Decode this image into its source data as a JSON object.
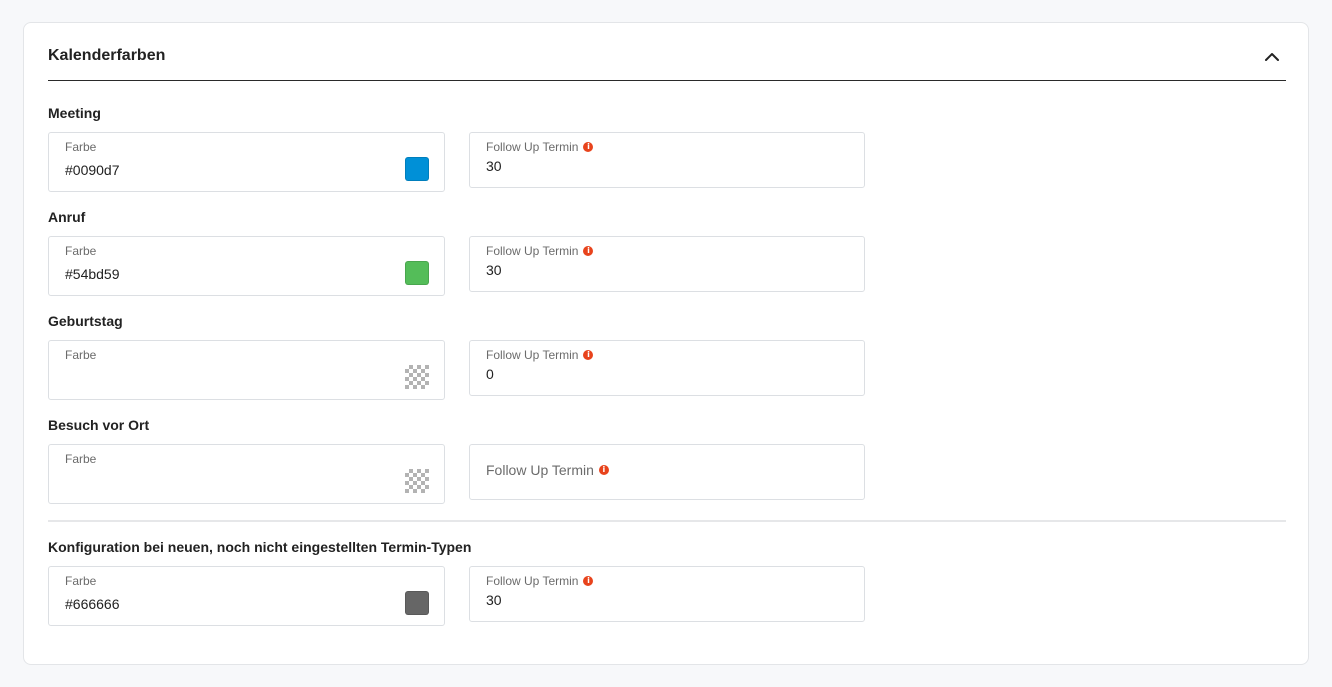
{
  "card": {
    "title": "Kalenderfarben"
  },
  "sections": [
    {
      "label": "Meeting",
      "color_label": "Farbe",
      "color_value": "#0090d7",
      "swatch": "#0090d7",
      "follow_label": "Follow Up Termin",
      "follow_value": "30"
    },
    {
      "label": "Anruf",
      "color_label": "Farbe",
      "color_value": "#54bd59",
      "swatch": "#54bd59",
      "follow_label": "Follow Up Termin",
      "follow_value": "30"
    },
    {
      "label": "Geburtstag",
      "color_label": "Farbe",
      "color_value": "",
      "swatch": "transparent",
      "follow_label": "Follow Up Termin",
      "follow_value": "0"
    },
    {
      "label": "Besuch vor Ort",
      "color_label": "Farbe",
      "color_value": "",
      "swatch": "transparent",
      "follow_label": "Follow Up Termin",
      "follow_value": ""
    },
    {
      "label": "Konfiguration bei neuen, noch nicht eingestellten Termin-Typen",
      "color_label": "Farbe",
      "color_value": "#666666",
      "swatch": "#666666",
      "follow_label": "Follow Up Termin",
      "follow_value": "30"
    }
  ],
  "icons": {
    "collapse": "chevron-up-icon",
    "info": "info-icon"
  },
  "colors": {
    "info": "#e8431c"
  }
}
